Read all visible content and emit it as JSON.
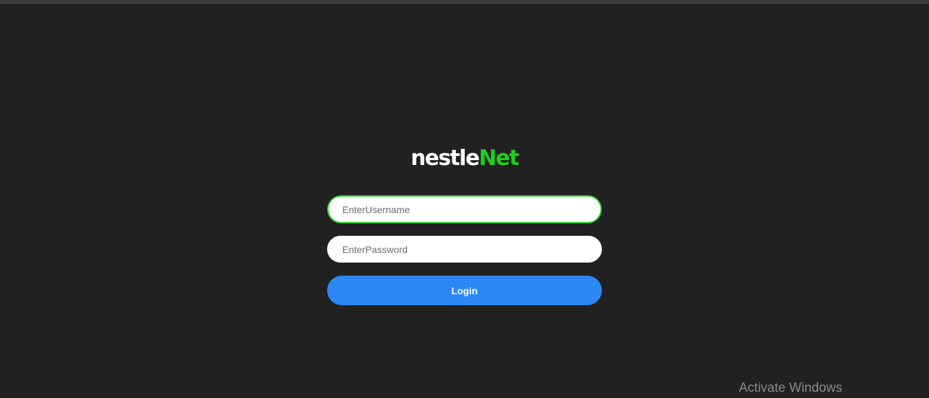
{
  "logo": {
    "part_1": "nestle",
    "part_2": "Net"
  },
  "form": {
    "username_placeholder": "EnterUsername",
    "username_value": "",
    "password_placeholder": "EnterPassword",
    "password_value": "",
    "login_label": "Login"
  },
  "watermark": {
    "text": "Activate Windows"
  },
  "colors": {
    "background": "#212121",
    "accent_green": "#1fcf1f",
    "button_blue": "#2d88f7"
  }
}
